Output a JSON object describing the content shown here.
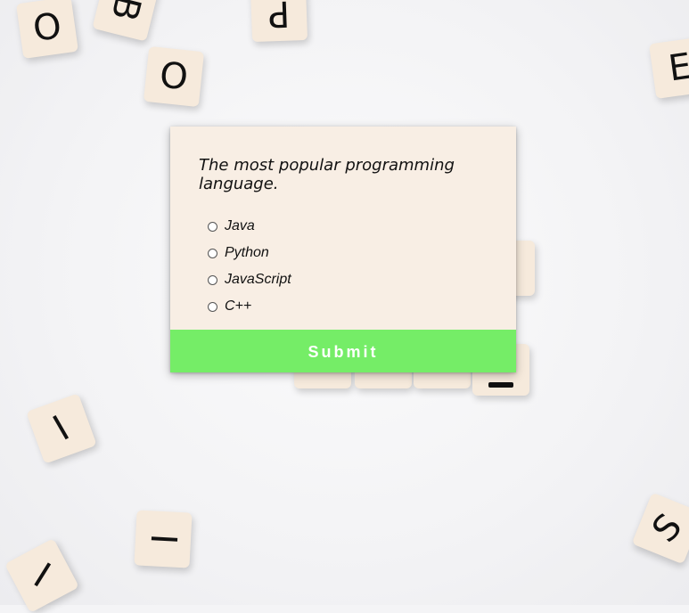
{
  "background": {
    "tiles": [
      "O",
      "B",
      "O",
      "P",
      "E",
      "I",
      "I",
      "I",
      "S"
    ]
  },
  "quiz": {
    "question": "The most popular programming language.",
    "options": [
      {
        "label": "Java"
      },
      {
        "label": "Python"
      },
      {
        "label": "JavaScript"
      },
      {
        "label": "C++"
      }
    ],
    "submit_label": "Submit",
    "accent_color": "#75ed67",
    "card_color": "#f8eee4"
  }
}
